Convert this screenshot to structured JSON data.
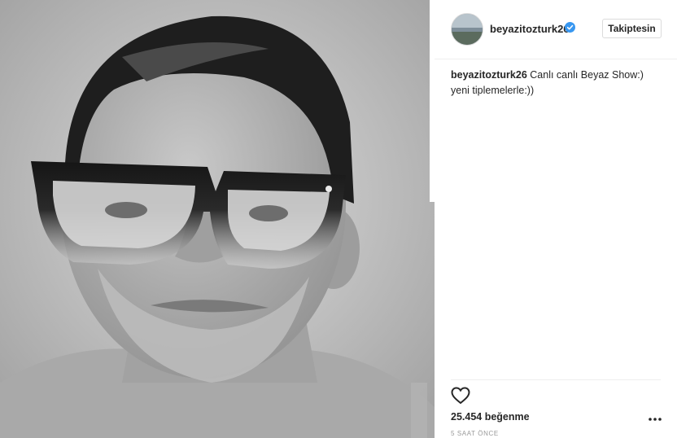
{
  "post": {
    "username": "beyazitozturk26",
    "follow_label": "Takiptesin",
    "caption": {
      "username": "beyazitozturk26",
      "text": "Canlı canlı Beyaz Show:) yeni tiplemelerle:))"
    },
    "likes": "25.454 beğenme",
    "time": "5 SAAT ÖNCE",
    "verified_icon": "verified-badge-icon",
    "like_icon": "heart-outline-icon",
    "more_icon": "more-options-icon"
  },
  "colors": {
    "verified_blue": "#3897f0",
    "text": "#262626",
    "muted": "#999999",
    "border": "#dbdbdb"
  }
}
